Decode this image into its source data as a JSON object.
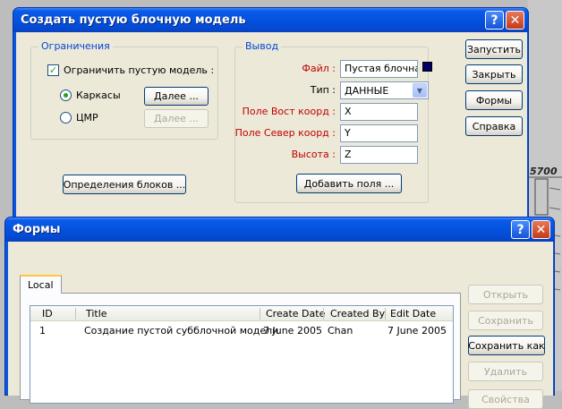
{
  "create_dialog": {
    "title": "Создать пустую блочную модель",
    "help_glyph": "?",
    "close_glyph": "✕",
    "limits_group": {
      "label": "Ограничения",
      "limit_checkbox_label": "Ограничить пустую модель :",
      "limit_checked": true,
      "check_glyph": "✓",
      "radio_wireframes": "Каркасы",
      "radio_dtm": "ЦМР",
      "selected": "wireframes",
      "next_button_1": "Далее ...",
      "next_button_2": "Далее ..."
    },
    "block_definitions_button": "Определения блоков ...",
    "output_group": {
      "label": "Вывод",
      "file_label": "Файл :",
      "file_value": "Пустая блочная",
      "swatch_color": "#000066",
      "type_label": "Тип :",
      "type_value": "ДАННЫЕ",
      "dropdown_glyph": "▼",
      "east_label": "Поле Вост коорд :",
      "east_value": "X",
      "north_label": "Поле Север коорд :",
      "north_value": "Y",
      "height_label": "Высота :",
      "height_value": "Z",
      "add_fields_button": "Добавить поля ..."
    },
    "side_buttons": {
      "run": "Запустить",
      "close": "Закрыть",
      "forms": "Формы",
      "help": "Справка"
    }
  },
  "forms_dialog": {
    "title": "Формы",
    "help_glyph": "?",
    "close_glyph": "✕",
    "tab_local": "Local",
    "columns": [
      "ID",
      "Title",
      "Create Date",
      "Created By",
      "Edit Date"
    ],
    "rows": [
      {
        "id": "1",
        "title": "Создание пустой субблочной модели",
        "create_date": "7 June 2005",
        "created_by": "Chan",
        "edit_date": "7 June 2005"
      }
    ],
    "buttons": {
      "open": "Открыть",
      "save": "Сохранить",
      "save_as": "Сохранить как",
      "delete": "Удалить",
      "properties": "Свойства"
    }
  },
  "background": {
    "label_5700": "5700"
  }
}
